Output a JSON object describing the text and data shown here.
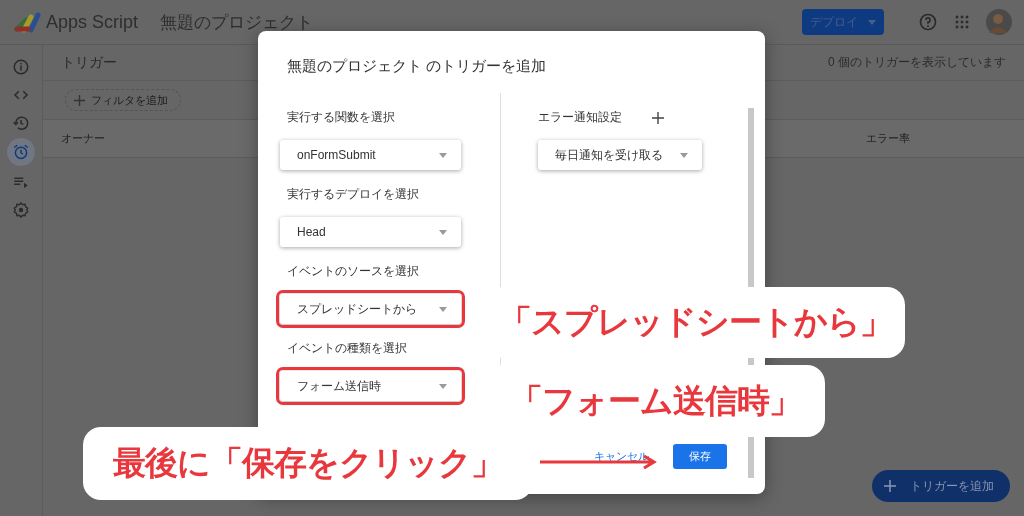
{
  "header": {
    "product": "Apps Script",
    "project_title": "無題のプロジェクト",
    "deploy_button": "デプロイ"
  },
  "sidebar": {
    "items": [
      {
        "kind": "info",
        "selected": false
      },
      {
        "kind": "code",
        "selected": false
      },
      {
        "kind": "history",
        "selected": false
      },
      {
        "kind": "triggers",
        "selected": true
      },
      {
        "kind": "executions",
        "selected": false
      },
      {
        "kind": "settings",
        "selected": false
      }
    ]
  },
  "triggers_panel": {
    "title": "トリガー",
    "count_text": "0 個のトリガーを表示しています",
    "filter_button": "フィルタを追加",
    "columns": [
      "オーナー",
      "エラー率"
    ],
    "add_button": "トリガーを追加"
  },
  "dialog": {
    "title": "無題のプロジェクト のトリガーを追加",
    "fields": [
      {
        "label": "実行する関数を選択",
        "value": "onFormSubmit",
        "highlighted": false
      },
      {
        "label": "実行するデプロイを選択",
        "value": "Head",
        "highlighted": false
      },
      {
        "label": "イベントのソースを選択",
        "value": "スプレッドシートから",
        "highlighted": true
      },
      {
        "label": "イベントの種類を選択",
        "value": "フォーム送信時",
        "highlighted": true
      }
    ],
    "error_notification": {
      "label": "エラー通知設定",
      "value": "毎日通知を受け取る"
    },
    "cancel_button": "キャンセル",
    "save_button": "保存"
  },
  "annotations": [
    {
      "text": "「スプレッドシートから」",
      "arrow": false
    },
    {
      "text": "「フォーム送信時」",
      "arrow": false
    },
    {
      "text": "最後に「保存をクリック」",
      "arrow": true
    }
  ]
}
